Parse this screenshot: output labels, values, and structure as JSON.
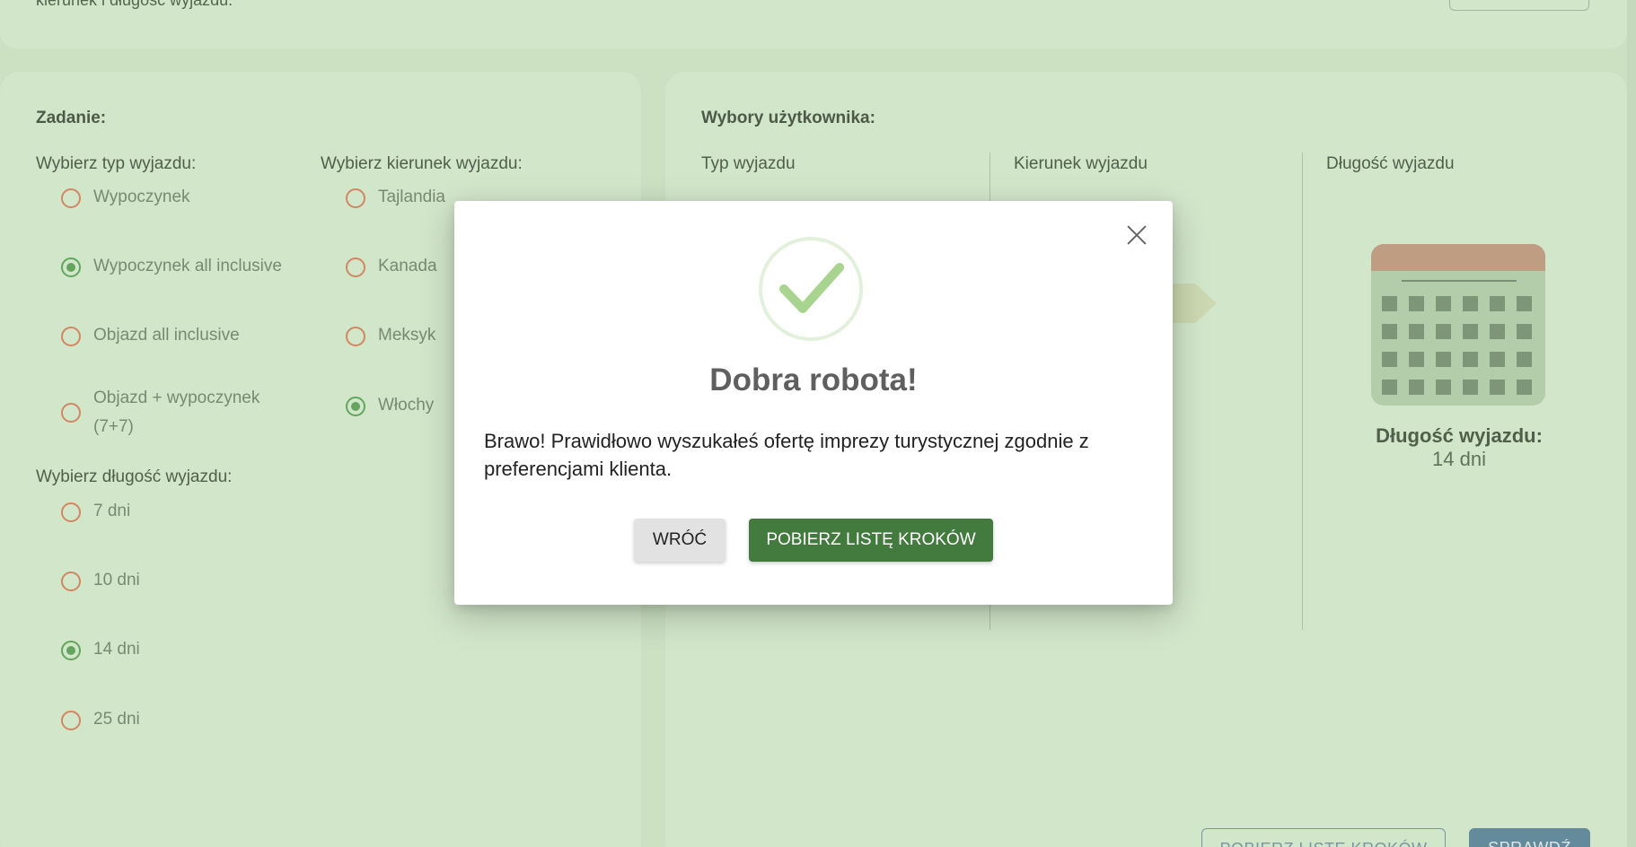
{
  "top": {
    "partial_text": "kierunek i długość wyjazdu."
  },
  "task": {
    "heading": "Zadanie:",
    "type_question": "Wybierz typ wyjazdu:",
    "types": [
      {
        "label": "Wypoczynek",
        "checked": false
      },
      {
        "label": "Wypoczynek all inclusive",
        "checked": true
      },
      {
        "label": "Objazd all inclusive",
        "checked": false
      },
      {
        "label": "Objazd + wypoczynek (7+7)",
        "checked": false
      }
    ],
    "direction_question": "Wybierz kierunek wyjazdu:",
    "directions": [
      {
        "label": "Tajlandia",
        "checked": false
      },
      {
        "label": "Kanada",
        "checked": false
      },
      {
        "label": "Meksyk",
        "checked": false
      },
      {
        "label": "Włochy",
        "checked": true
      }
    ],
    "length_question": "Wybierz długość wyjazdu:",
    "lengths": [
      {
        "label": "7 dni",
        "checked": false
      },
      {
        "label": "10 dni",
        "checked": false
      },
      {
        "label": "14 dni",
        "checked": true
      },
      {
        "label": "25 dni",
        "checked": false
      }
    ]
  },
  "choices": {
    "heading": "Wybory użytkownika:",
    "col_type": "Typ wyjazdu",
    "col_direction": "Kierunek wyjazdu",
    "col_length": "Długość wyjazdu",
    "length_title": "Długość wyjazdu:",
    "length_value": "14 dni"
  },
  "bottom": {
    "download_label": "POBIERZ LISTĘ KROKÓW",
    "check_label": "SPRAWDŹ"
  },
  "modal": {
    "title": "Dobra robota!",
    "text": "Brawo! Prawidłowo wyszukałeś ofertę imprezy turystycznej zgodnie z preferencjami klienta.",
    "back_label": "WRÓĆ",
    "download_label": "POBIERZ LISTĘ KROKÓW",
    "icon": "check-circle-icon",
    "accent_color": "#437a3e"
  }
}
